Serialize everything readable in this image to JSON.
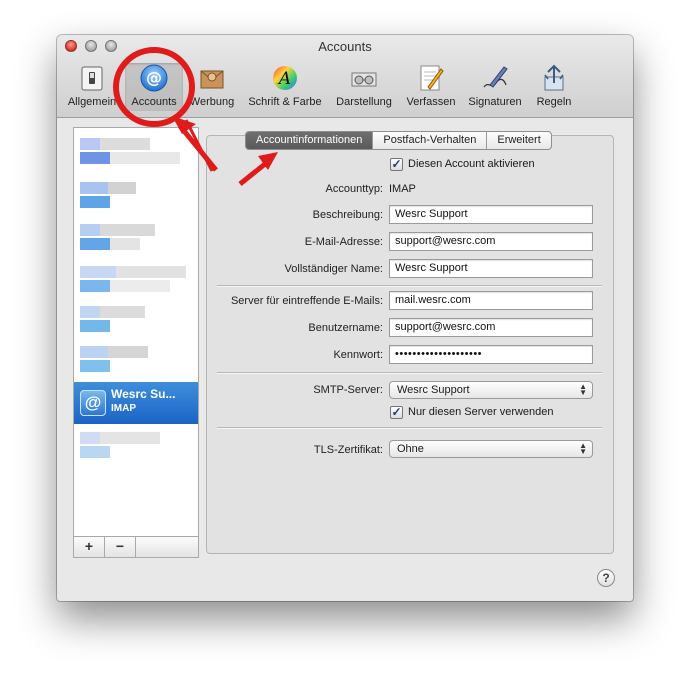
{
  "window": {
    "title": "Accounts"
  },
  "toolbar": {
    "items": [
      {
        "label": "Allgemein",
        "icon": "switch-icon"
      },
      {
        "label": "Accounts",
        "icon": "at-sign-icon"
      },
      {
        "label": "Werbung",
        "icon": "junk-mail-icon"
      },
      {
        "label": "Schrift & Farbe",
        "icon": "font-color-icon"
      },
      {
        "label": "Darstellung",
        "icon": "glasses-icon"
      },
      {
        "label": "Verfassen",
        "icon": "compose-pencil-icon"
      },
      {
        "label": "Signaturen",
        "icon": "signature-pen-icon"
      },
      {
        "label": "Regeln",
        "icon": "rules-arrows-icon"
      }
    ]
  },
  "sidebar": {
    "selected": {
      "name": "Wesrc Su...",
      "type": "IMAP",
      "icon_glyph": "@"
    },
    "add_label": "+",
    "remove_label": "−"
  },
  "tabs": [
    {
      "label": "Accountinformationen",
      "selected": true
    },
    {
      "label": "Postfach-Verhalten",
      "selected": false
    },
    {
      "label": "Erweitert",
      "selected": false
    }
  ],
  "form": {
    "enable_label": "Diesen Account aktivieren",
    "enable_checked": true,
    "account_type_label": "Accounttyp:",
    "account_type_value": "IMAP",
    "description_label": "Beschreibung:",
    "description_value": "Wesrc Support",
    "email_label": "E-Mail-Adresse:",
    "email_value": "support@wesrc.com",
    "fullname_label": "Vollständiger Name:",
    "fullname_value": "Wesrc Support",
    "incoming_server_label": "Server für eintreffende E-Mails:",
    "incoming_server_value": "mail.wesrc.com",
    "username_label": "Benutzername:",
    "username_value": "support@wesrc.com",
    "password_label": "Kennwort:",
    "password_value": "••••••••••••••••••••",
    "smtp_label": "SMTP-Server:",
    "smtp_value": "Wesrc Support",
    "only_server_label": "Nur diesen Server verwenden",
    "only_server_checked": true,
    "tls_label": "TLS-Zertifikat:",
    "tls_value": "Ohne"
  },
  "help": {
    "glyph": "?"
  },
  "colors": {
    "accent": "#1b63c6",
    "annotation": "#e01b1b"
  }
}
